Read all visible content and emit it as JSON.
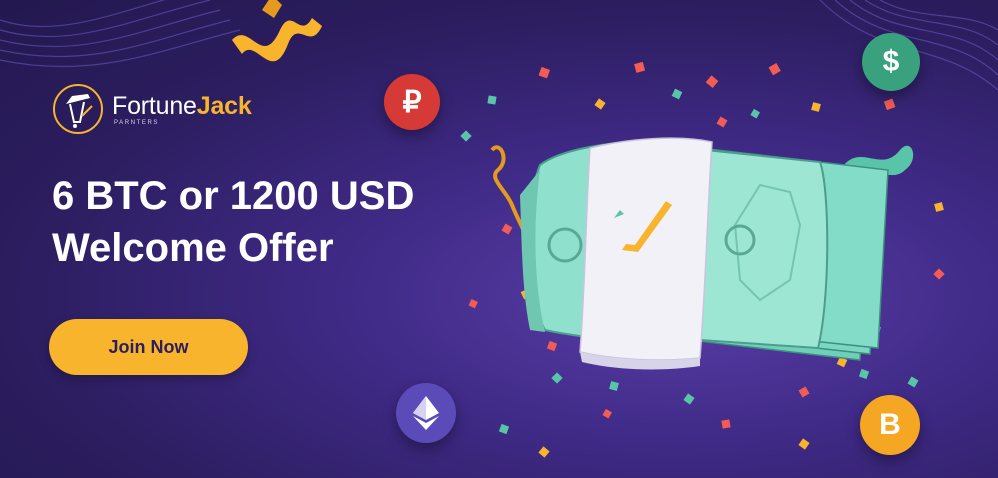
{
  "brand": {
    "name_part1": "Fortune",
    "name_part2": "Jack",
    "tagline": "PARNTERS"
  },
  "headline": {
    "line1": "6 BTC or 1200 USD",
    "line2": "Welcome Offer"
  },
  "cta": {
    "label": "Join Now"
  },
  "coins": {
    "ruble": {
      "symbol": "₽",
      "color": "#d63a36"
    },
    "dollar": {
      "symbol": "$",
      "color": "#3aa17e"
    },
    "ethereum": {
      "icon": "ethereum-icon",
      "color": "#5b4bb8"
    },
    "bitcoin": {
      "symbol": "B",
      "color": "#f5a623"
    }
  },
  "colors": {
    "background": "#2b1d5e",
    "accent": "#f7b42c",
    "text": "#ffffff",
    "money": "#8fe0cc"
  }
}
